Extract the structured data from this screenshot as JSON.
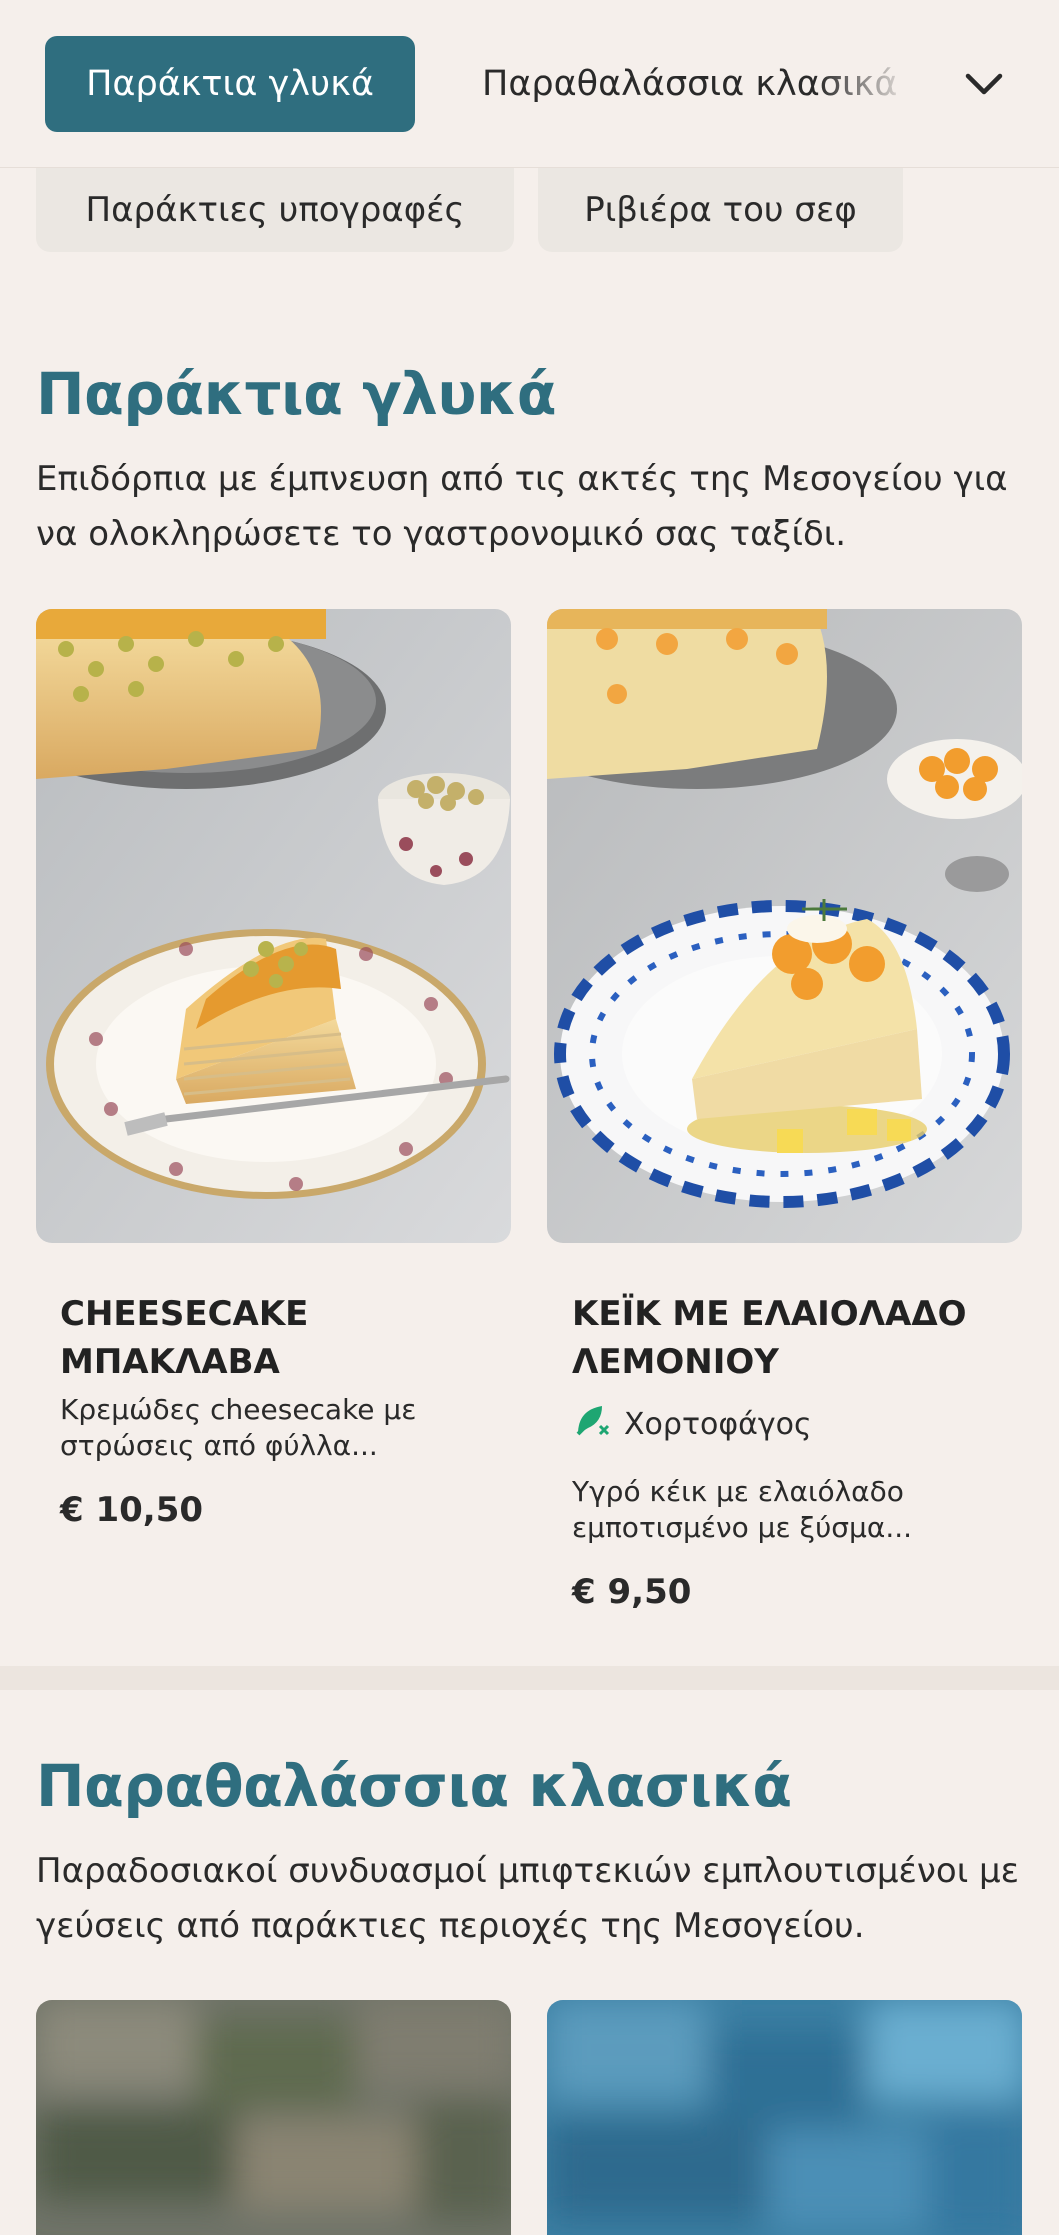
{
  "nav": {
    "active_category": "Παράκτια γλυκά",
    "next_category": "Παραθαλάσσια κλασικά",
    "more_icon": "chevron-down-icon",
    "chips": [
      "Παράκτιες υπογραφές",
      "Ριβιέρα του σεφ"
    ]
  },
  "sections": [
    {
      "title": "Παράκτια γλυκά",
      "description": "Επιδόρπια με έμπνευση από τις ακτές της Μεσογείου για να ολοκληρώσετε το γαστρονομικό σας ταξίδι.",
      "items": [
        {
          "name": "CHEESECAKE ΜΠΑΚΛΑΒΑ",
          "description": "Κρεμώδες cheesecake με στρώσεις από φύλλα...",
          "price": "€ 10,50"
        },
        {
          "name": "ΚΕΪΚ ΜΕ ΕΛΑΙΟΛΑΔΟ ΛΕΜΟΝΙΟΥ",
          "tag": "Χορτοφάγος",
          "tag_icon": "vegetarian-leaf-icon",
          "description": "Υγρό κέικ με ελαιόλαδο εμποτισμένο με ξύσμα...",
          "price": "€ 9,50"
        }
      ]
    },
    {
      "title": "Παραθαλάσσια κλασικά",
      "description": "Παραδοσιακοί συνδυασμοί μπιφτεκιών εμπλουτισμένοι με γεύσεις από παράκτιες περιοχές της Μεσογείου."
    }
  ],
  "colors": {
    "accent": "#2f6e7f",
    "background": "#f5efeb",
    "chip": "#ebe7e2",
    "veg_green": "#1ea672"
  }
}
